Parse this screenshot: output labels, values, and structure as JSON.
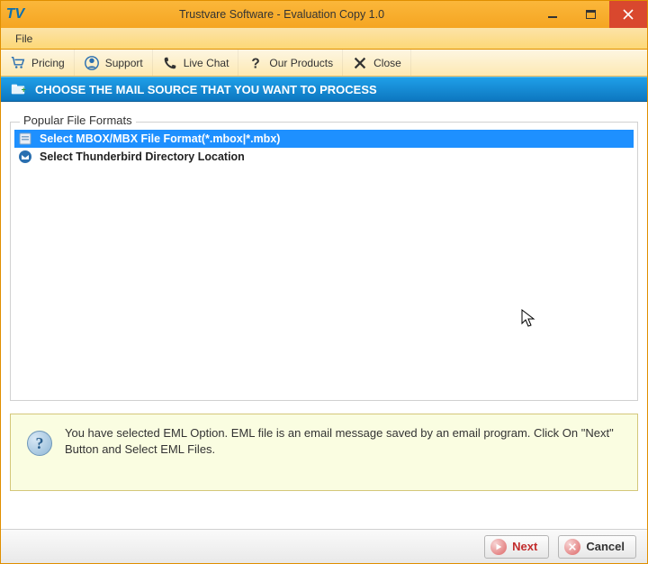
{
  "window": {
    "title": "Trustvare Software - Evaluation Copy 1.0",
    "logo": "TV"
  },
  "menu": {
    "file": "File"
  },
  "toolbar": {
    "pricing": "Pricing",
    "support": "Support",
    "livechat": "Live Chat",
    "products": "Our Products",
    "close": "Close"
  },
  "section": {
    "title": "CHOOSE THE MAIL SOURCE THAT YOU WANT TO PROCESS"
  },
  "formats": {
    "legend": "Popular File Formats",
    "items": [
      {
        "label": "Select MBOX/MBX File Format(*.mbox|*.mbx)",
        "selected": true
      },
      {
        "label": "Select Thunderbird Directory Location",
        "selected": false
      }
    ]
  },
  "hint": {
    "text": "You have selected EML Option. EML file is an email message saved by an email program. Click On \"Next\" Button and Select EML Files."
  },
  "footer": {
    "next": "Next",
    "cancel": "Cancel"
  }
}
